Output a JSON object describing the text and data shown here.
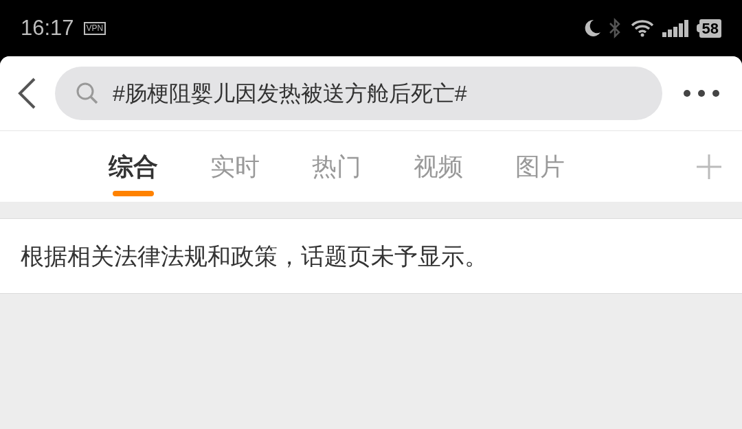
{
  "status_bar": {
    "time": "16:17",
    "vpn": "VPN",
    "battery": "58"
  },
  "search": {
    "value": "#肠梗阻婴儿因发热被送方舱后死亡#"
  },
  "tabs": [
    {
      "label": "综合",
      "selected": true
    },
    {
      "label": "实时",
      "selected": false
    },
    {
      "label": "热门",
      "selected": false
    },
    {
      "label": "视频",
      "selected": false
    },
    {
      "label": "图片",
      "selected": false
    }
  ],
  "notice": "根据相关法律法规和政策，话题页未予显示。"
}
